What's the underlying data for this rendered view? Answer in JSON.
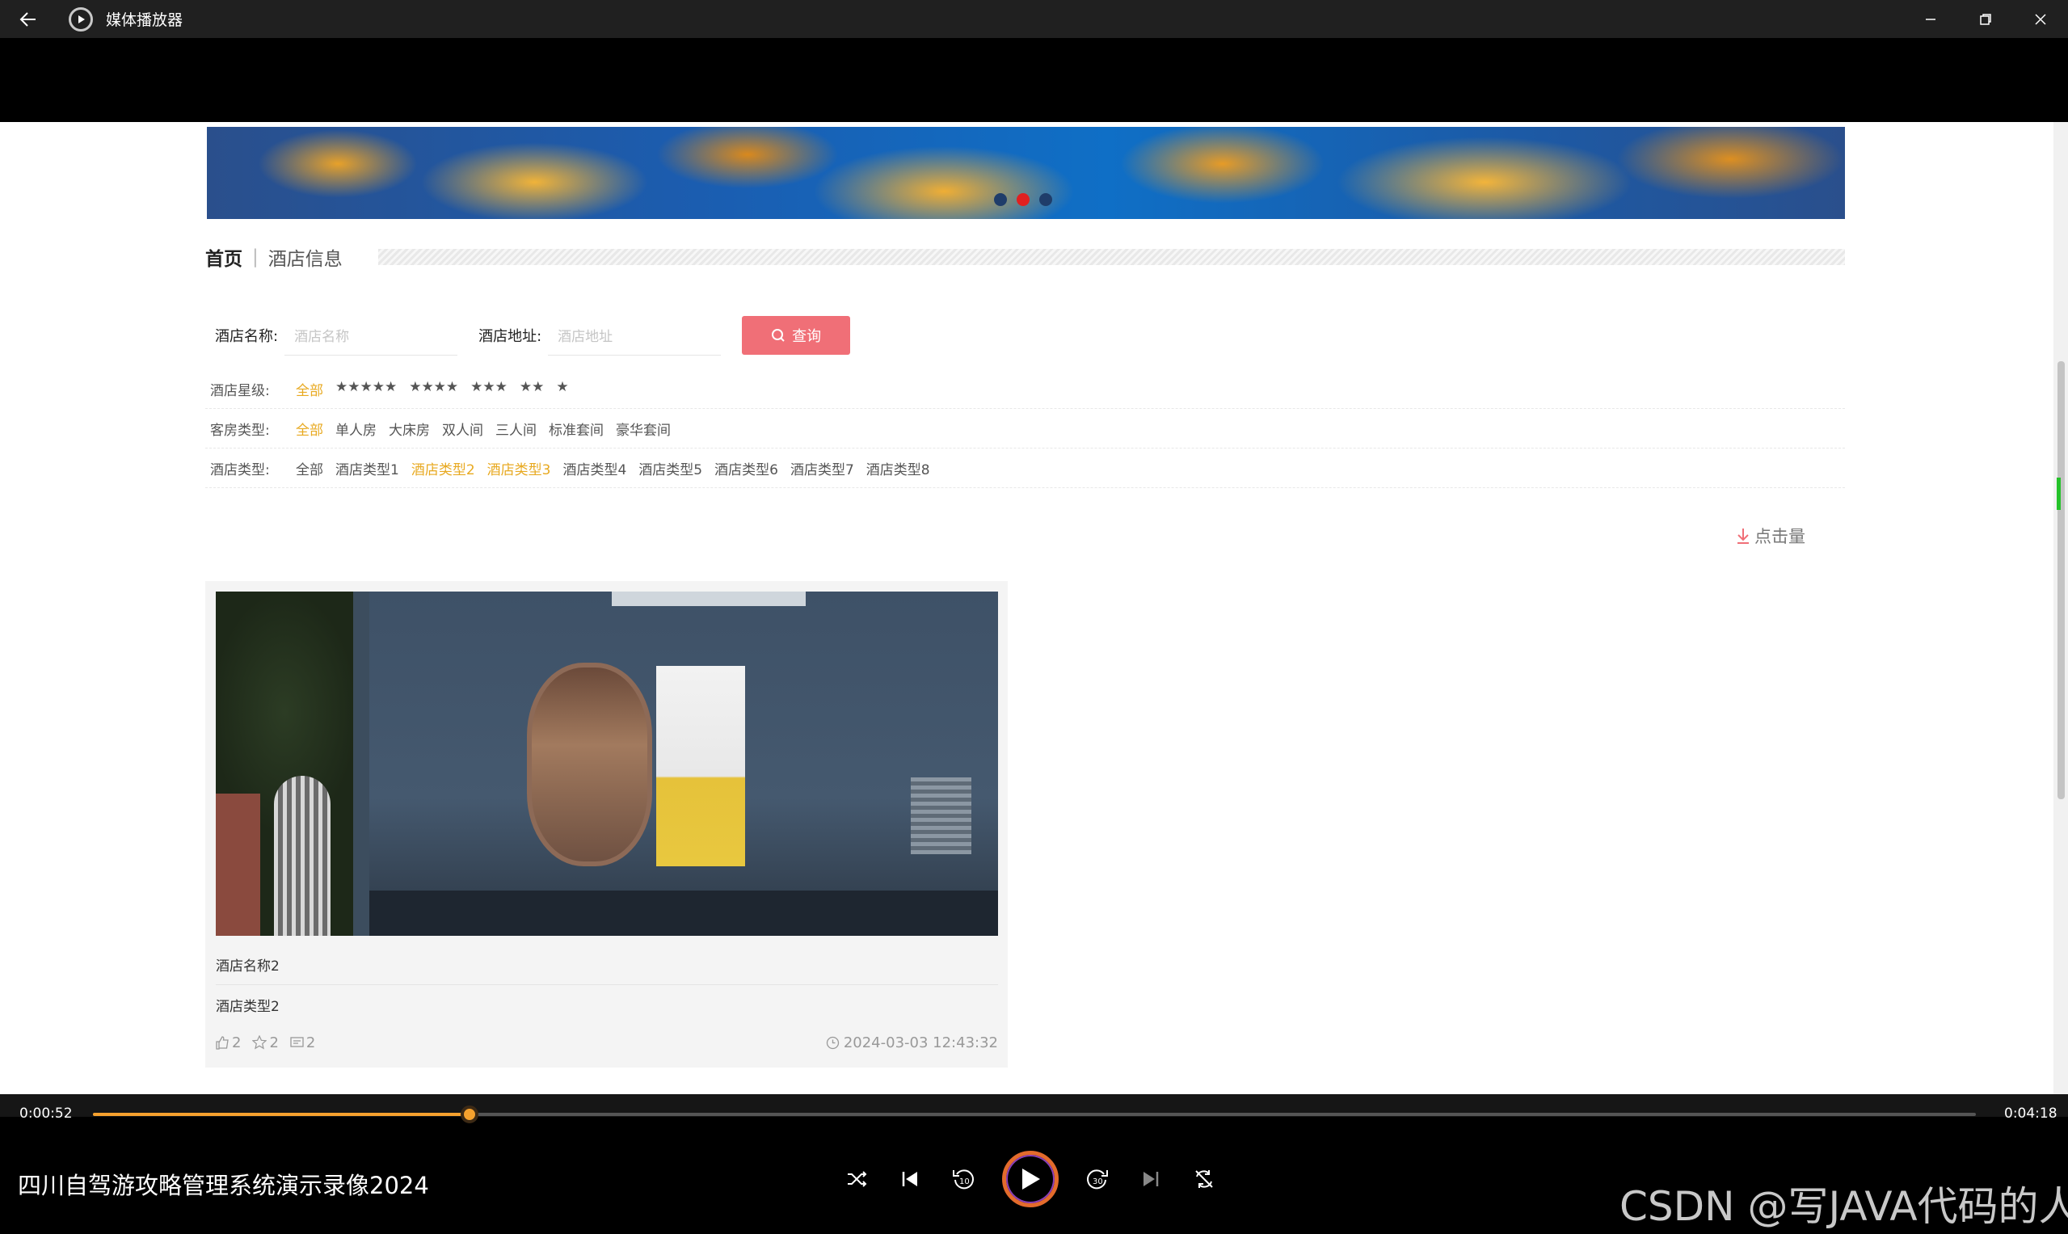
{
  "window": {
    "title": "媒体播放器"
  },
  "breadcrumb": {
    "home": "首页",
    "separator": "|",
    "current": "酒店信息"
  },
  "search": {
    "name_label": "酒店名称:",
    "name_placeholder": "酒店名称",
    "address_label": "酒店地址:",
    "address_placeholder": "酒店地址",
    "button_label": "查询"
  },
  "filters": {
    "star": {
      "label": "酒店星级:",
      "options": [
        "全部",
        "★★★★★",
        "★★★★",
        "★★★",
        "★★",
        "★"
      ],
      "selected": 0
    },
    "room": {
      "label": "客房类型:",
      "options": [
        "全部",
        "单人房",
        "大床房",
        "双人间",
        "三人间",
        "标准套间",
        "豪华套间"
      ],
      "selected": 0
    },
    "hotel_type": {
      "label": "酒店类型:",
      "options": [
        "全部",
        "酒店类型1",
        "酒店类型2",
        "酒店类型3",
        "酒店类型4",
        "酒店类型5",
        "酒店类型6",
        "酒店类型7",
        "酒店类型8"
      ],
      "selected": [
        2,
        3
      ]
    }
  },
  "sort": {
    "label": "点击量"
  },
  "banner": {
    "slide_count": 3,
    "active_slide": 2
  },
  "card": {
    "name": "酒店名称2",
    "type": "酒店类型2",
    "likes": "2",
    "stars": "2",
    "comments": "2",
    "time": "2024-03-03 12:43:32"
  },
  "player": {
    "current_time": "0:00:52",
    "total_time": "0:04:18",
    "progress": 0.2016,
    "title": "四川自驾游攻略管理系统演示录像2024"
  },
  "watermark": "CSDN @写JAVA代码的人",
  "colors": {
    "accent": "#f06f77",
    "selected": "#e8a920",
    "progress": "#f5a12e"
  }
}
